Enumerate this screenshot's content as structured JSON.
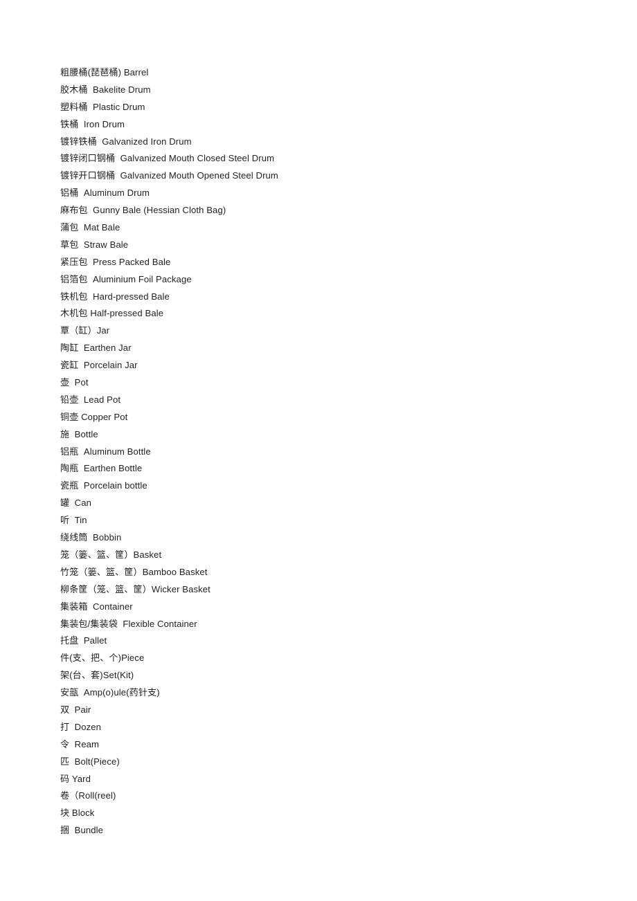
{
  "document": {
    "background_color": "#ffffff",
    "text_color": "#231f20",
    "entry_count": 46
  },
  "glossary": {
    "entries": [
      {
        "text": "粗腰桶(琵琶桶) Barrel",
        "zh": "粗腰桶(琵琶桶)",
        "en": "Barrel"
      },
      {
        "text": "胶木桶  Bakelite Drum",
        "zh": "胶木桶",
        "en": "Bakelite Drum"
      },
      {
        "text": "塑料桶  Plastic Drum",
        "zh": "塑料桶",
        "en": "Plastic Drum"
      },
      {
        "text": "铁桶  Iron Drum",
        "zh": "铁桶",
        "en": "Iron Drum"
      },
      {
        "text": "镀锌铁桶  Galvanized Iron Drum",
        "zh": "镀锌铁桶",
        "en": "Galvanized Iron Drum"
      },
      {
        "text": "镀锌闭口钢桶  Galvanized Mouth Closed Steel Drum",
        "zh": "镀锌闭口钢桶",
        "en": "Galvanized Mouth Closed Steel Drum"
      },
      {
        "text": "镀锌开口钢桶  Galvanized Mouth Opened Steel Drum",
        "zh": "镀锌开口钢桶",
        "en": "Galvanized Mouth Opened Steel Drum"
      },
      {
        "text": "铝桶  Aluminum Drum",
        "zh": "铝桶",
        "en": "Aluminum Drum"
      },
      {
        "text": "麻布包  Gunny Bale (Hessian Cloth Bag)",
        "zh": "麻布包",
        "en": "Gunny Bale (Hessian Cloth Bag)"
      },
      {
        "text": "蒲包  Mat Bale",
        "zh": "蒲包",
        "en": "Mat Bale"
      },
      {
        "text": "草包  Straw Bale",
        "zh": "草包",
        "en": "Straw Bale"
      },
      {
        "text": "紧压包  Press Packed Bale",
        "zh": "紧压包",
        "en": "Press Packed Bale"
      },
      {
        "text": "铝箔包  Aluminium Foil Package",
        "zh": "铝箔包",
        "en": "Aluminium Foil Package"
      },
      {
        "text": "铁机包  Hard-pressed Bale",
        "zh": "铁机包",
        "en": "Hard-pressed Bale"
      },
      {
        "text": "木机包 Half-pressed Bale",
        "zh": "木机包",
        "en": "Half-pressed Bale"
      },
      {
        "text": "覃（缸）Jar",
        "zh": "覃（缸）",
        "en": "Jar"
      },
      {
        "text": "陶缸  Earthen Jar",
        "zh": "陶缸",
        "en": "Earthen Jar"
      },
      {
        "text": "瓷缸  Porcelain Jar",
        "zh": "瓷缸",
        "en": "Porcelain Jar"
      },
      {
        "text": "壶  Pot",
        "zh": "壶",
        "en": "Pot"
      },
      {
        "text": "铅壶  Lead Pot",
        "zh": "铅壶",
        "en": "Lead Pot"
      },
      {
        "text": "铜壶 Copper Pot",
        "zh": "铜壶",
        "en": "Copper Pot"
      },
      {
        "text": "施  Bottle",
        "zh": "施",
        "en": "Bottle"
      },
      {
        "text": "铝瓶  Aluminum Bottle",
        "zh": "铝瓶",
        "en": "Aluminum Bottle"
      },
      {
        "text": "陶瓶  Earthen Bottle",
        "zh": "陶瓶",
        "en": "Earthen Bottle"
      },
      {
        "text": "瓷瓶  Porcelain bottle",
        "zh": "瓷瓶",
        "en": "Porcelain bottle"
      },
      {
        "text": "罐  Can",
        "zh": "罐",
        "en": "Can"
      },
      {
        "text": "听  Tin",
        "zh": "听",
        "en": "Tin"
      },
      {
        "text": "绕线筒  Bobbin",
        "zh": "绕线筒",
        "en": "Bobbin"
      },
      {
        "text": "笼（篓、篮、筐）Basket",
        "zh": "笼（篓、篮、筐）",
        "en": "Basket"
      },
      {
        "text": "竹笼（篓、篮、筐）Bamboo Basket",
        "zh": "竹笼（篓、篮、筐）",
        "en": "Bamboo Basket"
      },
      {
        "text": "柳条筐（笼、篮、筐）Wicker Basket",
        "zh": "柳条筐（笼、篮、筐）",
        "en": "Wicker Basket"
      },
      {
        "text": "集装箱  Container",
        "zh": "集装箱",
        "en": "Container"
      },
      {
        "text": "集装包/集装袋  Flexible Container",
        "zh": "集装包/集装袋",
        "en": "Flexible Container"
      },
      {
        "text": "托盘  Pallet",
        "zh": "托盘",
        "en": "Pallet"
      },
      {
        "text": "件(支、把、个)Piece",
        "zh": "件(支、把、个)",
        "en": "Piece"
      },
      {
        "text": "架(台、套)Set(Kit)",
        "zh": "架(台、套)",
        "en": "Set(Kit)"
      },
      {
        "text": "安瓿  Amp(o)ule(药针支)",
        "zh": "安瓿",
        "en": "Amp(o)ule(药针支)"
      },
      {
        "text": "双  Pair",
        "zh": "双",
        "en": "Pair"
      },
      {
        "text": "打  Dozen",
        "zh": "打",
        "en": "Dozen"
      },
      {
        "text": "令  Ream",
        "zh": "令",
        "en": "Ream"
      },
      {
        "text": "匹  Bolt(Piece)",
        "zh": "匹",
        "en": "Bolt(Piece)"
      },
      {
        "text": "码 Yard",
        "zh": "码",
        "en": "Yard"
      },
      {
        "text": "卷（Roll(reel)",
        "zh": "卷（",
        "en": "Roll(reel)"
      },
      {
        "text": "块 Block",
        "zh": "块",
        "en": "Block"
      },
      {
        "text": "捆  Bundle",
        "zh": "捆",
        "en": "Bundle"
      }
    ]
  }
}
